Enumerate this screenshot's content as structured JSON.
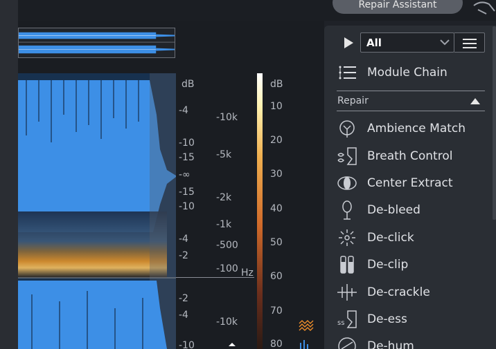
{
  "header": {
    "repair_assistant_label": "Repair Assistant"
  },
  "scales": {
    "db_left": [
      {
        "label": "dB",
        "y": 0
      },
      {
        "label": "-4",
        "y": 0
      },
      {
        "label": "-10",
        "y": 0
      },
      {
        "label": "-15",
        "y": 0
      },
      {
        "label": "-∞",
        "y": 0
      },
      {
        "label": "-15",
        "y": 0
      },
      {
        "label": "-10",
        "y": 0
      },
      {
        "label": "-4",
        "y": 0
      },
      {
        "label": "-2",
        "y": 0
      },
      {
        "label": "-2",
        "y": 0
      },
      {
        "label": "-4",
        "y": 0
      },
      {
        "label": "-10",
        "y": 0
      }
    ],
    "hz": [
      {
        "label": "-10k"
      },
      {
        "label": "-5k"
      },
      {
        "label": "-2k"
      },
      {
        "label": "-1k"
      },
      {
        "label": "-500"
      },
      {
        "label": "-100"
      },
      {
        "label": "Hz"
      },
      {
        "label": "-10k"
      }
    ],
    "db_color": [
      {
        "label": "dB"
      },
      {
        "label": "10"
      },
      {
        "label": "20"
      },
      {
        "label": "30"
      },
      {
        "label": "40"
      },
      {
        "label": "50"
      },
      {
        "label": "60"
      },
      {
        "label": "70"
      },
      {
        "label": "80"
      }
    ]
  },
  "panel": {
    "filter_value": "All",
    "module_chain_label": "Module Chain",
    "section_label": "Repair",
    "modules": [
      {
        "label": "Ambience Match",
        "icon": "ambience-match-icon"
      },
      {
        "label": "Breath Control",
        "icon": "breath-control-icon"
      },
      {
        "label": "Center Extract",
        "icon": "center-extract-icon"
      },
      {
        "label": "De-bleed",
        "icon": "de-bleed-icon"
      },
      {
        "label": "De-click",
        "icon": "de-click-icon"
      },
      {
        "label": "De-clip",
        "icon": "de-clip-icon"
      },
      {
        "label": "De-crackle",
        "icon": "de-crackle-icon"
      },
      {
        "label": "De-ess",
        "icon": "de-ess-icon"
      },
      {
        "label": "De-hum",
        "icon": "de-hum-icon"
      }
    ]
  },
  "colors": {
    "waveform_blue": "#3d8fe6",
    "panel_bg": "#2a2e34",
    "accent_orange": "#e88a2a"
  }
}
